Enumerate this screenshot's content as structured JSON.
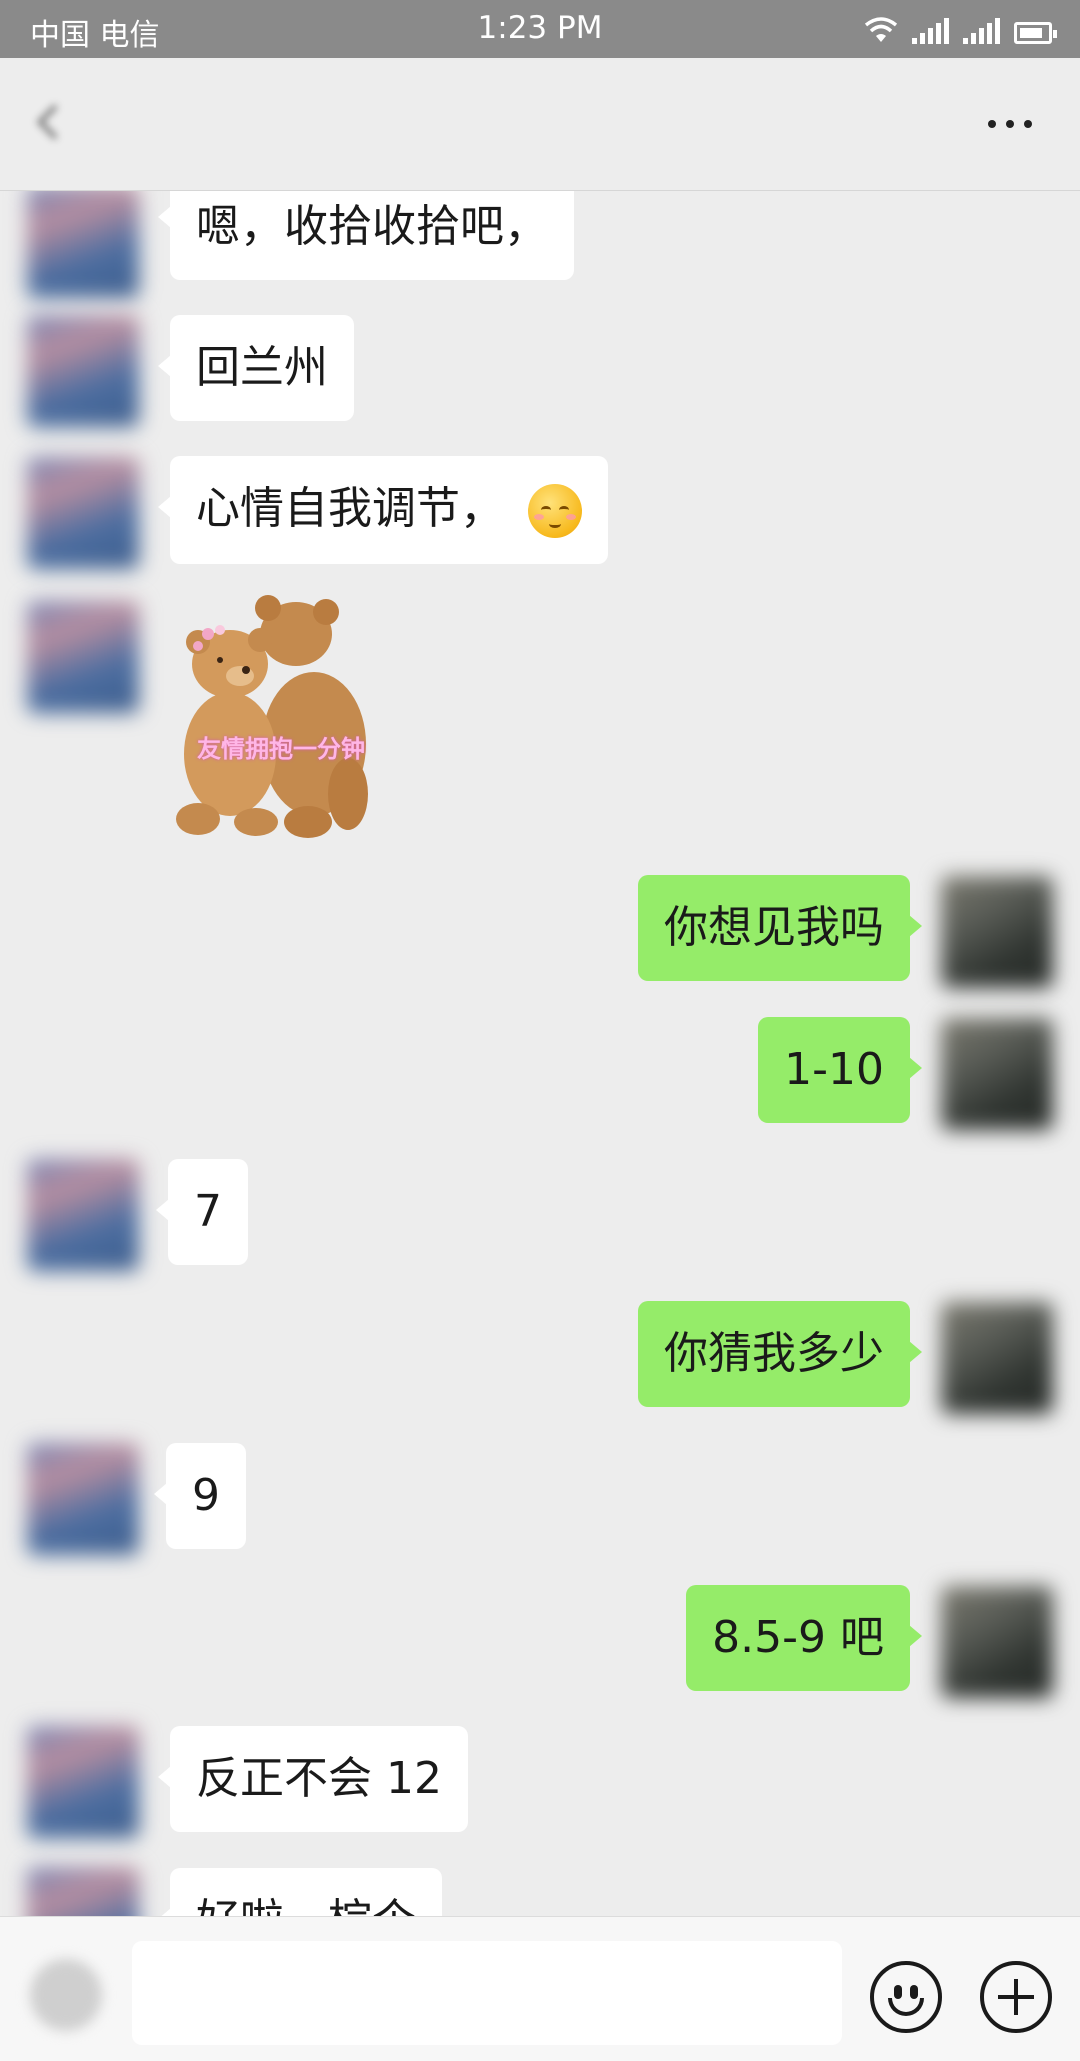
{
  "status_bar": {
    "carrier": "中国 电信",
    "time": "1:23 PM"
  },
  "header": {
    "title": "",
    "more_icon": "more-icon"
  },
  "messages": [
    {
      "side": "in",
      "text": "嗯，收拾收拾吧，"
    },
    {
      "side": "in",
      "text": "回兰州"
    },
    {
      "side": "in",
      "text": "心情自我调节，",
      "emoji": "blushing-smile-emoji"
    },
    {
      "side": "in",
      "type": "sticker",
      "caption": "友情拥抱一分钟"
    },
    {
      "side": "out",
      "text": "你想见我吗"
    },
    {
      "side": "out",
      "text": "1-10"
    },
    {
      "side": "in",
      "text": "7"
    },
    {
      "side": "out",
      "text": "你猜我多少"
    },
    {
      "side": "in",
      "text": "9"
    },
    {
      "side": "out",
      "text": "8.5-9 吧"
    },
    {
      "side": "in",
      "text": "反正不会 12"
    },
    {
      "side": "in",
      "text": "好啦，棕个"
    }
  ],
  "input_bar": {
    "value": "",
    "icons": [
      "voice-icon",
      "emoji-icon",
      "plus-icon"
    ]
  },
  "colors": {
    "background": "#ededed",
    "outgoing_bubble": "#95ec69",
    "incoming_bubble": "#ffffff",
    "status_bar": "#8a8a8a"
  }
}
